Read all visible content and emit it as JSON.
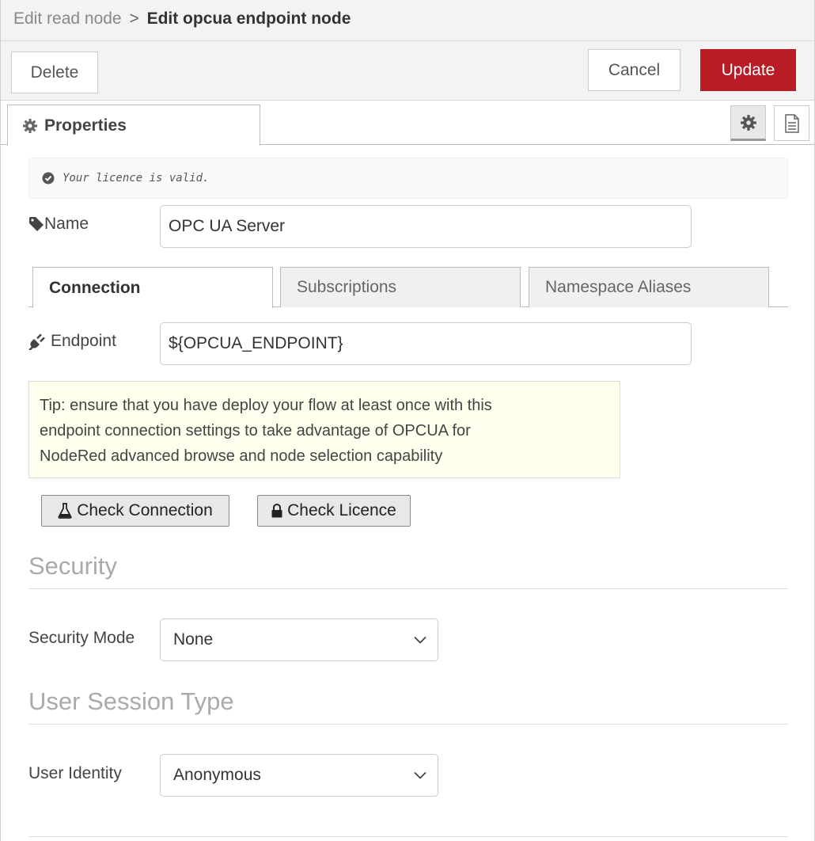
{
  "header": {
    "parent": "Edit read node",
    "separator": ">",
    "current": "Edit opcua endpoint node"
  },
  "toolbar": {
    "delete_label": "Delete",
    "cancel_label": "Cancel",
    "update_label": "Update"
  },
  "tabs": {
    "properties_label": "Properties",
    "icons": [
      "gear-icon",
      "document-icon"
    ]
  },
  "licence": {
    "message": "Your licence is valid."
  },
  "name_field": {
    "label": "Name",
    "value": "OPC UA Server"
  },
  "subtabs": [
    {
      "label": "Connection",
      "active": true
    },
    {
      "label": "Subscriptions",
      "active": false
    },
    {
      "label": "Namespace Aliases",
      "active": false
    }
  ],
  "endpoint_field": {
    "label": "Endpoint",
    "value": "${OPCUA_ENDPOINT}"
  },
  "tip": {
    "lines": [
      "Tip: ensure that you have deploy your flow at least once with this",
      "endpoint connection settings to take advantage of OPCUA for",
      "NodeRed advanced browse and node selection capability"
    ]
  },
  "actions": {
    "check_connection": "Check Connection",
    "check_licence": "Check Licence"
  },
  "security": {
    "title": "Security",
    "mode_label": "Security Mode",
    "mode_value": "None"
  },
  "session": {
    "title": "User Session Type",
    "identity_label": "User Identity",
    "identity_value": "Anonymous"
  },
  "colors": {
    "update_button": "#b91c24",
    "tip_background": "#ffffee",
    "section_title": "#aaaaaa"
  }
}
